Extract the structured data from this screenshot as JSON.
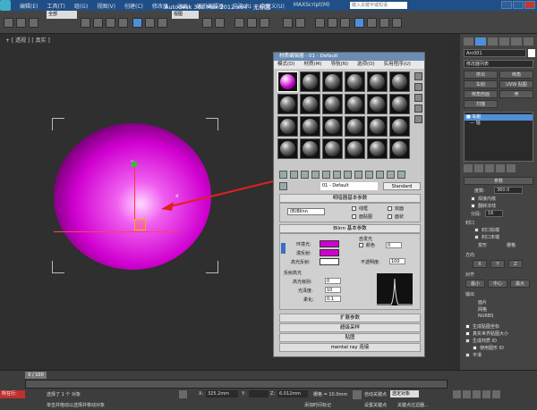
{
  "titlebar": {
    "title": "Autodesk 3ds Max  2012 x64 - 无标题",
    "menus": [
      "编辑(E)",
      "工具(T)",
      "组(G)",
      "视图(V)",
      "创建(C)",
      "修改器",
      "动画",
      "图形编辑器",
      "渲染(R)",
      "自定义(U)",
      "MAXScript(M)"
    ],
    "search_placeholder": "键入关键字或短语"
  },
  "toolbar": {
    "selection_filter": "全部",
    "view_dropdown": "视图"
  },
  "viewport": {
    "label": "+ [ 透视 ] [ 真实 ]",
    "gizmo_y": "y",
    "gizmo_x": "x"
  },
  "material_editor": {
    "title": "材质编辑器 - 01 - Default",
    "menus": [
      "模式(D)",
      "材质(M)",
      "导航(N)",
      "选项(O)",
      "实用程序(U)"
    ],
    "material_name": "01 - Default",
    "material_type": "Standard",
    "shader_rollout": "明暗器基本参数",
    "shader": "(B)Blinn",
    "shader_options": [
      "线框",
      "双面",
      "面贴图",
      "面状"
    ],
    "blinn_rollout": "Blinn 基本参数",
    "self_illum_label": "自发光",
    "color_label": "颜色",
    "color_value": "0",
    "ambient_label": "环境光:",
    "diffuse_label": "漫反射:",
    "specular_label": "高光反射:",
    "opacity_label": "不透明度:",
    "opacity_value": "100",
    "specular_highlights": "反射高光",
    "spec_level_label": "高光级别:",
    "spec_level_value": "0",
    "glossiness_label": "光泽度:",
    "glossiness_value": "10",
    "soften_label": "柔化:",
    "soften_value": "0.1",
    "rollouts": [
      "扩展参数",
      "超级采样",
      "贴图",
      "mental ray 连接"
    ]
  },
  "command_panel": {
    "object_name": "Arc001",
    "modifier_list": "修改器列表",
    "buttons": [
      "挤出",
      "倒角",
      "车削",
      "UVW 贴图",
      "倒角剖面",
      "壳",
      "扫描"
    ],
    "stack_items": [
      "■ 车削",
      "— 轴"
    ],
    "params_title": "参数",
    "degrees_label": "度数:",
    "degrees_value": "360.0",
    "weld_core": "焊接内核",
    "flip_normals": "翻转法线",
    "segments_label": "分段:",
    "segments_value": "16",
    "capping_title": "封口",
    "cap_start": "封口始端",
    "cap_end": "封口末端",
    "morph": "变形",
    "grid": "栅格",
    "direction_title": "方向",
    "dir_buttons": [
      "X",
      "Y",
      "Z"
    ],
    "align_title": "对齐",
    "align_buttons": [
      "最小",
      "中心",
      "最大"
    ],
    "output_title": "输出",
    "output_options": [
      "面片",
      "网格",
      "NURBS"
    ],
    "gen_map_coords": "生成贴图坐标",
    "real_world": "真实世界贴图大小",
    "gen_mat_ids": "生成材质 ID",
    "use_shape_ids": "使用图形 ID",
    "smooth": "平滑"
  },
  "status": {
    "frame": "0 / 100",
    "selected": "选择了 1 个 对象",
    "hint": "单击并拖动以选择并移动对象",
    "x_label": "X:",
    "x_value": "325.2mm",
    "y_label": "Y:",
    "y_value": "",
    "z_label": "Z:",
    "z_value": "6.012mm",
    "grid": "栅格 = 10.0mm",
    "autokey": "自动关键点",
    "selected_set": "选定对象",
    "set_key": "设置关键点",
    "key_filter": "关键点过滤器...",
    "add_time_tag": "添加时间标记",
    "welcome": "所在行:"
  }
}
